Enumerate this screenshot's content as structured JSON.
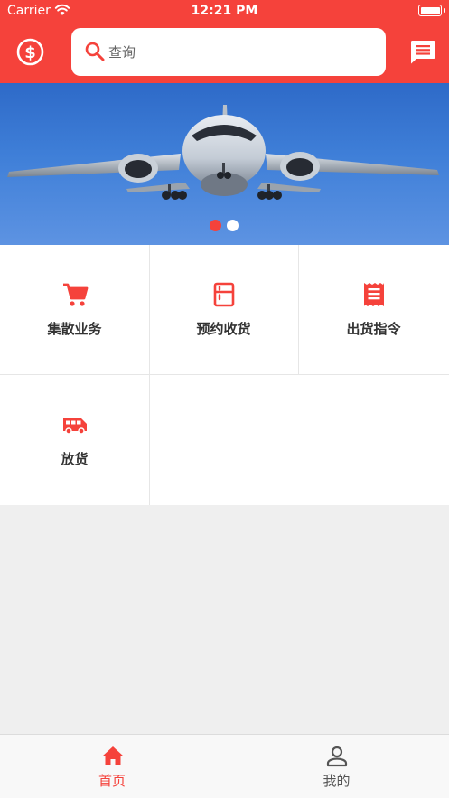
{
  "status_bar": {
    "carrier": "Carrier",
    "time": "12:21 PM"
  },
  "header": {
    "currency_icon": "dollar-circle-icon",
    "search": {
      "placeholder": "查询",
      "value": ""
    },
    "message_icon": "message-icon",
    "accent_color": "#f5423b"
  },
  "banner": {
    "image": "airplane-photo",
    "dots": [
      {
        "active": true
      },
      {
        "active": false
      }
    ]
  },
  "menu": {
    "items": [
      {
        "label": "集散业务",
        "icon": "cart-icon"
      },
      {
        "label": "预约收货",
        "icon": "fridge-icon"
      },
      {
        "label": "出货指令",
        "icon": "receipt-icon"
      },
      {
        "label": "放货",
        "icon": "van-icon"
      }
    ]
  },
  "tabbar": {
    "tabs": [
      {
        "label": "首页",
        "icon": "home-icon",
        "active": true
      },
      {
        "label": "我的",
        "icon": "person-icon",
        "active": false
      }
    ],
    "active_color": "#f5423b",
    "inactive_color": "#555555"
  }
}
